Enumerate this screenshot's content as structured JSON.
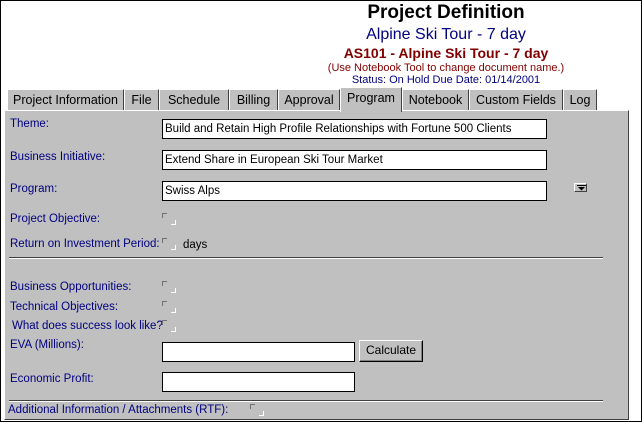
{
  "header": {
    "title": "Project Definition",
    "subtitle": "Alpine Ski Tour - 7 day",
    "code_title": "AS101 - Alpine Ski Tour - 7 day",
    "notebook_hint": "(Use Notebook Tool to change document name.)",
    "status_line": "Status: On Hold  Due Date: 01/14/2001"
  },
  "tabs": [
    {
      "label": "Project Information"
    },
    {
      "label": "File"
    },
    {
      "label": "Schedule"
    },
    {
      "label": "Billing"
    },
    {
      "label": "Approval"
    },
    {
      "label": "Program",
      "active": true
    },
    {
      "label": "Notebook"
    },
    {
      "label": "Custom Fields"
    },
    {
      "label": "Log"
    }
  ],
  "form": {
    "theme_label": "Theme:",
    "theme_value": "Build and Retain High Profile Relationships with Fortune 500 Clients",
    "initiative_label": "Business Initiative:",
    "initiative_value": "Extend Share in  European Ski Tour Market",
    "program_label": "Program:",
    "program_value": "Swiss Alps",
    "objective_label": "Project Objective:",
    "roi_label": "Return on Investment Period:",
    "roi_unit": "days",
    "opportunities_label": "Business Opportunities:",
    "technical_label": "Technical Objectives:",
    "success_label": "What does success look like?",
    "eva_label": "EVA (Millions):",
    "eva_value": "",
    "calculate_label": "Calculate",
    "profit_label": "Economic Profit:",
    "profit_value": "",
    "attachments_label": "Additional Information / Attachments (RTF):"
  },
  "colors": {
    "label": "#000080",
    "title": "#000000",
    "subtitle": "#000080",
    "code_title": "#800000",
    "panel": "#c0c0c0"
  }
}
